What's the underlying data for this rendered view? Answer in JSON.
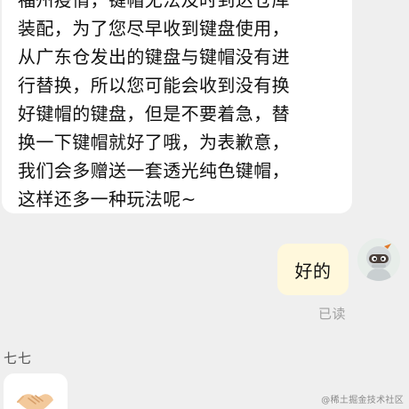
{
  "messages": {
    "incoming_long": {
      "lines": [
        "福州疫情，键帽无法及时到达仓库",
        "装配，为了您尽早收到键盘使用，",
        "从广东仓发出的键盘与键帽没有进",
        "行替换，所以您可能会收到没有换",
        "好键帽的键盘，但是不要着急，替",
        "换一下键帽就好了哦，为表歉意，",
        "我们会多赠送一套透光纯色键帽，",
        "这样还多一种玩法呢~"
      ]
    },
    "outgoing": {
      "text": "好的",
      "status": "已读",
      "avatar_icon": "ninja-avatar-icon"
    },
    "incoming_short": {
      "sender": "七七",
      "emoji": "handshake-emoji"
    }
  },
  "watermark": "@稀土掘金技术社区",
  "colors": {
    "background": "#efefef",
    "incoming_bubble": "#ffffff",
    "outgoing_bubble": "#fff8dc",
    "status_text": "#a0a0a0"
  }
}
